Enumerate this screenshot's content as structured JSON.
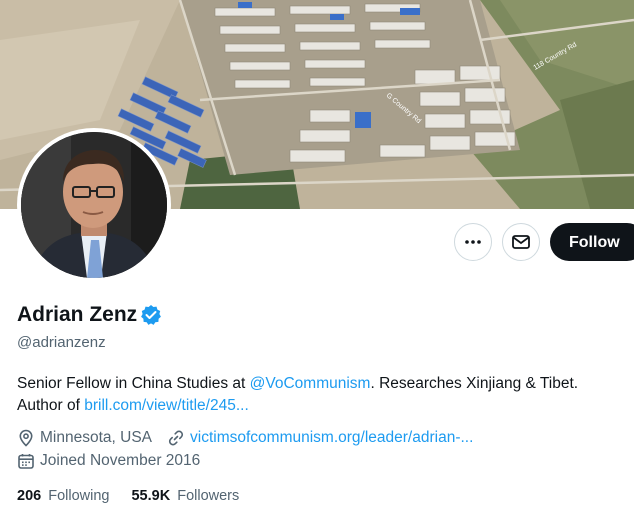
{
  "profile": {
    "name": "Adrian Zenz",
    "handle": "@adrianzenz",
    "bio_prefix": "Senior Fellow in China Studies at ",
    "bio_mention": "@VoCommunism",
    "bio_middle": ". Researches Xinjiang & Tibet.",
    "bio_author": "Author of ",
    "bio_link": "brill.com/view/title/245...",
    "location": "Minnesota, USA",
    "website": "victimsofcommunism.org/leader/adrian-...",
    "joined": "Joined November 2016",
    "following_count": "206",
    "following_label": "Following",
    "followers_count": "55.9K",
    "followers_label": "Followers"
  },
  "actions": {
    "follow_label": "Follow",
    "more_icon": "more-horizontal-icon",
    "message_icon": "envelope-icon"
  },
  "colors": {
    "accent": "#1d9bf0",
    "text": "#0f1419",
    "secondary": "#536471",
    "follow_bg": "#0f1419"
  }
}
